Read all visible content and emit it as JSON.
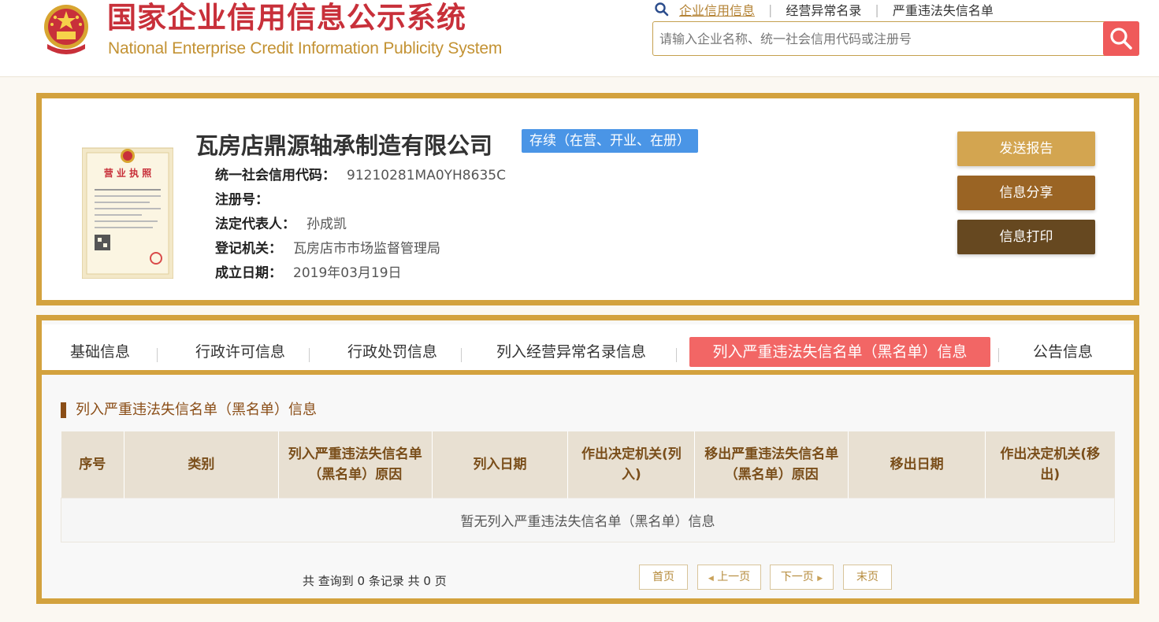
{
  "header": {
    "title_cn": "国家企业信用信息公示系统",
    "title_en": "National Enterprise Credit Information Publicity System",
    "links": [
      "企业信用信息",
      "经营异常名录",
      "严重违法失信名单"
    ],
    "search_placeholder": "请输入企业名称、统一社会信用代码或注册号"
  },
  "company": {
    "name": "瓦房店鼎源轴承制造有限公司",
    "status": "存续（在营、开业、在册）",
    "license_title": "营 业 执 照",
    "fields": [
      {
        "label": "统一社会信用代码：",
        "value": "91210281MA0YH8635C"
      },
      {
        "label": "注册号：",
        "value": ""
      },
      {
        "label": "法定代表人：",
        "value": "孙成凯"
      },
      {
        "label": "登记机关：",
        "value": "瓦房店市市场监督管理局"
      },
      {
        "label": "成立日期：",
        "value": "2019年03月19日"
      }
    ],
    "buttons": [
      "发送报告",
      "信息分享",
      "信息打印"
    ]
  },
  "tabs": {
    "items": [
      "基础信息",
      "行政许可信息",
      "行政处罚信息",
      "列入经营异常名录信息",
      "列入严重违法失信名单（黑名单）信息",
      "公告信息"
    ],
    "active_index": 4
  },
  "section": {
    "title": "列入严重违法失信名单（黑名单）信息",
    "columns": [
      "序号",
      "类别",
      "列入严重违法失信名单（黑名单）原因",
      "列入日期",
      "作出决定机关(列入)",
      "移出严重违法失信名单（黑名单）原因",
      "移出日期",
      "作出决定机关(移出)"
    ],
    "empty_text": "暂无列入严重违法失信名单（黑名单）信息"
  },
  "pager": {
    "summary": "共 查询到 0 条记录 共 0 页",
    "first": "首页",
    "prev": "上一页",
    "next": "下一页",
    "last": "末页"
  },
  "colors": {
    "brand_red": "#c8303a",
    "gold": "#d3a23e",
    "active_tab": "#f26665",
    "status_blue": "#4a95e6",
    "btn_send": "#d3a550",
    "btn_share": "#9a6424",
    "btn_print": "#664820"
  }
}
